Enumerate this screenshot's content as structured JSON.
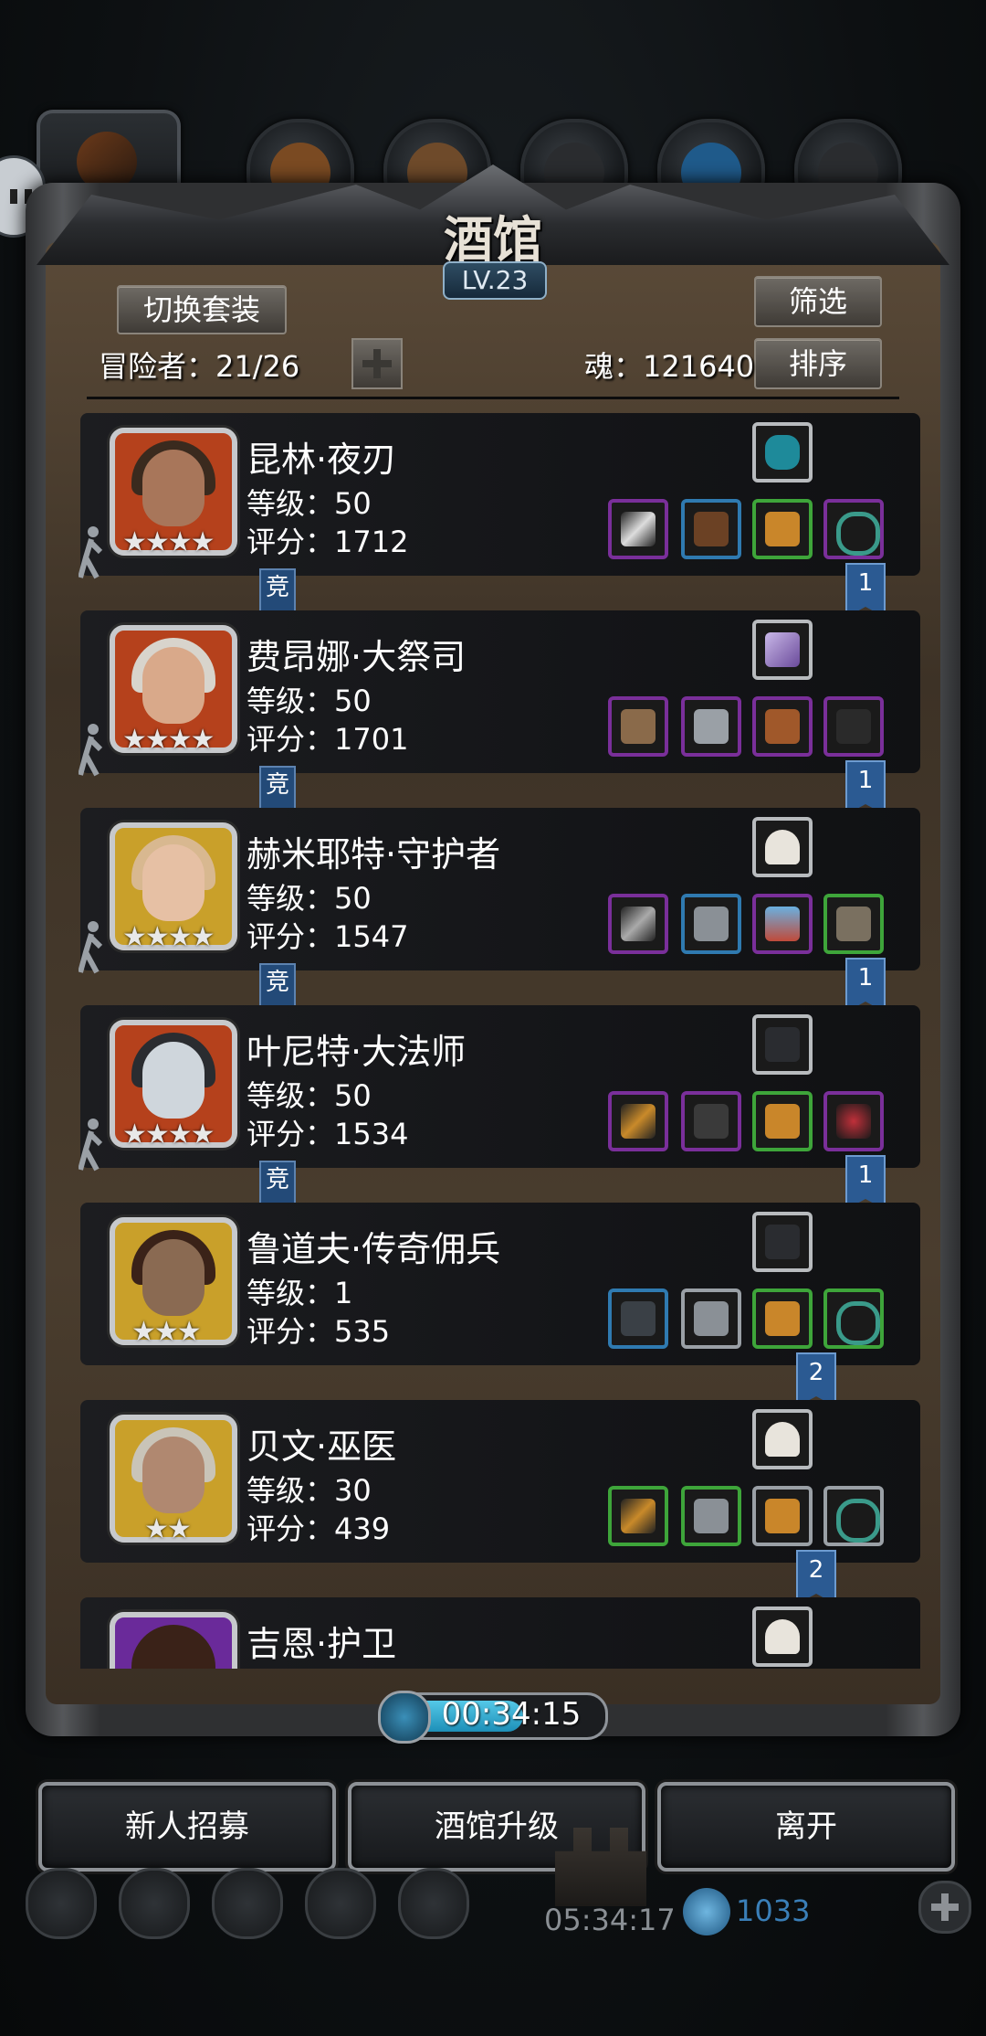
{
  "header": {
    "title": "酒馆",
    "level": "LV.23",
    "switch_outfit": "切换套装",
    "filter": "筛选",
    "sort": "排序",
    "adventurers_label": "冒险者：21/26",
    "soul_label": "魂：121640"
  },
  "heroes": [
    {
      "name": "昆林·夜刃",
      "level": "等级：50",
      "score": "评分：1712",
      "stars": "★★★★",
      "badge": "竞",
      "rank": "1",
      "frame": "red"
    },
    {
      "name": "费昂娜·大祭司",
      "level": "等级：50",
      "score": "评分：1701",
      "stars": "★★★★",
      "badge": "竞",
      "rank": "1",
      "frame": "red"
    },
    {
      "name": "赫米耶特·守护者",
      "level": "等级：50",
      "score": "评分：1547",
      "stars": "★★★★",
      "badge": "竞",
      "rank": "1",
      "frame": "gold"
    },
    {
      "name": "叶尼特·大法师",
      "level": "等级：50",
      "score": "评分：1534",
      "stars": "★★★★",
      "badge": "竞",
      "rank": "1",
      "frame": "red"
    },
    {
      "name": "鲁道夫·传奇佣兵",
      "level": "等级：1",
      "score": "评分：535",
      "stars": "★★★",
      "badge": "",
      "rank": "2",
      "frame": "gold"
    },
    {
      "name": "贝文·巫医",
      "level": "等级：30",
      "score": "评分：439",
      "stars": "★★",
      "badge": "",
      "rank": "2",
      "frame": "gold"
    },
    {
      "name": "吉恩·护卫",
      "level": "",
      "score": "",
      "stars": "",
      "badge": "",
      "rank": "",
      "frame": "purple"
    }
  ],
  "timer": "00:34:15",
  "buttons": {
    "recruit": "新人招募",
    "upgrade": "酒馆升级",
    "leave": "离开"
  },
  "bottom": {
    "time": "05:34:17",
    "currency": "1033"
  }
}
